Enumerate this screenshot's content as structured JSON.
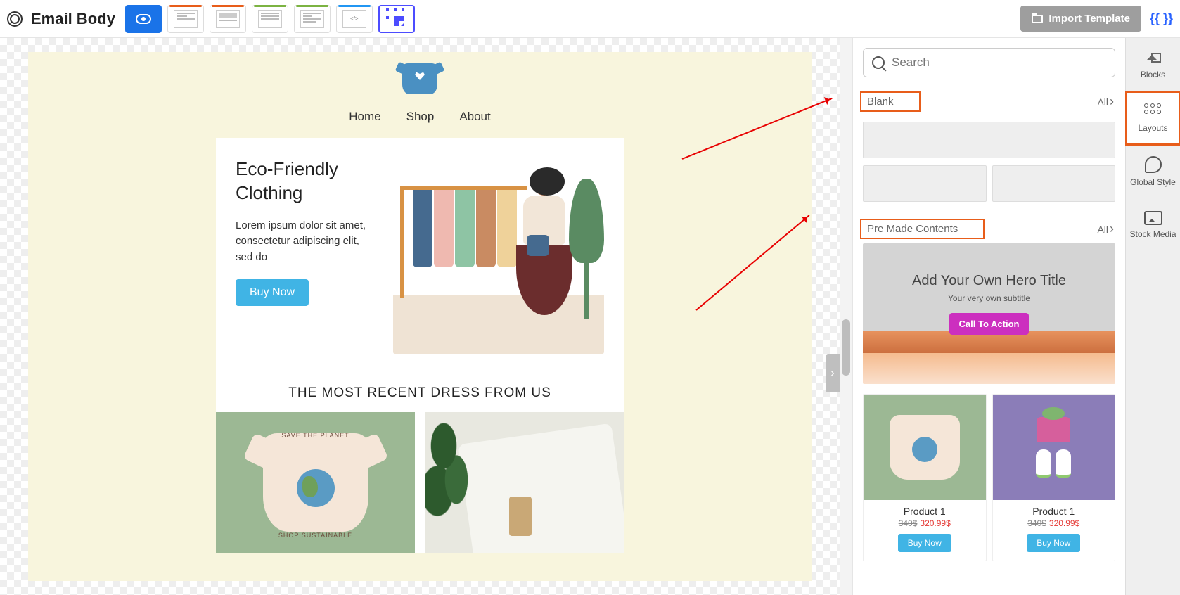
{
  "header": {
    "title": "Email Body",
    "import_label": "Import Template"
  },
  "email": {
    "nav": [
      "Home",
      "Shop",
      "About"
    ],
    "hero": {
      "title": "Eco-Friendly Clothing",
      "body": "Lorem ipsum dolor sit amet, consectetur adipiscing elit, sed do",
      "cta": "Buy Now"
    },
    "section_title": "THE MOST RECENT DRESS FROM US",
    "product_badges": {
      "top": "SAVE THE PLANET",
      "bottom": "SHOP SUSTAINABLE"
    }
  },
  "panel": {
    "search_placeholder": "Search",
    "sections": {
      "blank": {
        "label": "Blank",
        "all": "All"
      },
      "premade": {
        "label": "Pre Made Contents",
        "all": "All"
      }
    },
    "hero_preview": {
      "title": "Add Your Own Hero Title",
      "subtitle": "Your very own subtitle",
      "cta": "Call To Action"
    },
    "products": [
      {
        "name": "Product 1",
        "old": "340$",
        "new": "320.99$",
        "cta": "Buy Now"
      },
      {
        "name": "Product 1",
        "old": "340$",
        "new": "320.99$",
        "cta": "Buy Now"
      }
    ]
  },
  "rail": {
    "blocks": "Blocks",
    "layouts": "Layouts",
    "global": "Global Style",
    "media": "Stock Media"
  }
}
